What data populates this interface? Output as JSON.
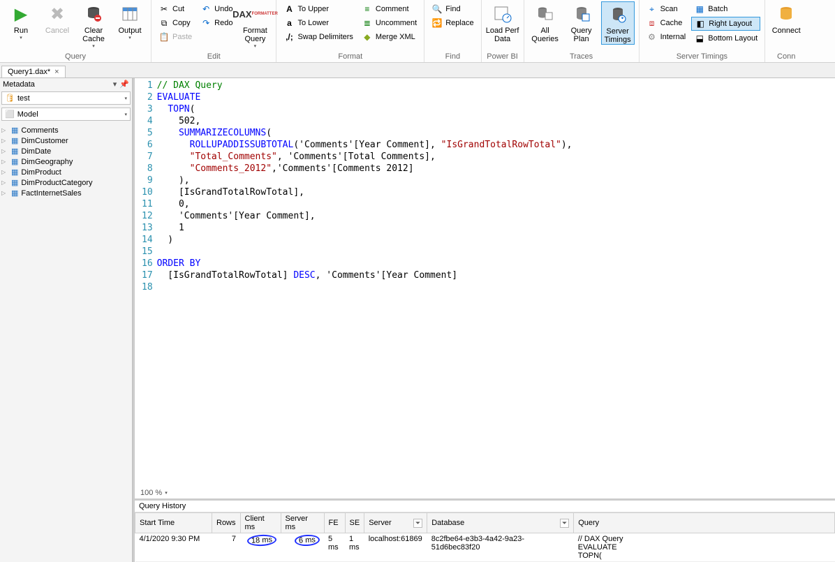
{
  "ribbon": {
    "groups": {
      "query": {
        "label": "Query",
        "run": "Run",
        "cancel": "Cancel",
        "clear": "Clear Cache",
        "output": "Output"
      },
      "edit": {
        "label": "Edit",
        "cut": "Cut",
        "copy": "Copy",
        "paste": "Paste",
        "undo": "Undo",
        "redo": "Redo",
        "format": "Format Query"
      },
      "format": {
        "label": "Format",
        "upper": "To Upper",
        "lower": "To Lower",
        "swap": "Swap Delimiters",
        "comment": "Comment",
        "uncomment": "Uncomment",
        "merge": "Merge XML"
      },
      "find": {
        "label": "Find",
        "find": "Find",
        "replace": "Replace"
      },
      "powerbi": {
        "label": "Power BI",
        "load": "Load Perf Data"
      },
      "traces": {
        "label": "Traces",
        "all": "All Queries",
        "plan": "Query Plan",
        "timings": "Server Timings"
      },
      "servertimings": {
        "label": "Server Timings",
        "scan": "Scan",
        "cache": "Cache",
        "internal": "Internal",
        "batch": "Batch",
        "right": "Right Layout",
        "bottom": "Bottom Layout"
      },
      "conn": {
        "label": "Conn",
        "connect": "Connect"
      }
    }
  },
  "tab": {
    "name": "Query1.dax*",
    "close": "×"
  },
  "metadata": {
    "title": "Metadata",
    "db": "test",
    "model": "Model",
    "tables": [
      "Comments",
      "DimCustomer",
      "DimDate",
      "DimGeography",
      "DimProduct",
      "DimProductCategory",
      "FactInternetSales"
    ]
  },
  "editor": {
    "zoom": "100 %",
    "lines": [
      {
        "n": "1",
        "h": "<span class='c-green'>// DAX Query</span>"
      },
      {
        "n": "2",
        "h": "<span class='c-blue'>EVALUATE</span>"
      },
      {
        "n": "3",
        "h": "  <span class='c-blue'>TOPN</span>("
      },
      {
        "n": "4",
        "h": "    502,"
      },
      {
        "n": "5",
        "h": "    <span class='c-blue'>SUMMARIZECOLUMNS</span>("
      },
      {
        "n": "6",
        "h": "      <span class='c-blue'>ROLLUPADDISSUBTOTAL</span>('Comments'[Year Comment], <span class='c-red'>\"IsGrandTotalRowTotal\"</span>),"
      },
      {
        "n": "7",
        "h": "      <span class='c-red'>\"Total_Comments\"</span>, 'Comments'[Total Comments],"
      },
      {
        "n": "8",
        "h": "      <span class='c-red'>\"Comments_2012\"</span>,'Comments'[Comments 2012]"
      },
      {
        "n": "9",
        "h": "    ),"
      },
      {
        "n": "10",
        "h": "    [IsGrandTotalRowTotal],"
      },
      {
        "n": "11",
        "h": "    0,"
      },
      {
        "n": "12",
        "h": "    'Comments'[Year Comment],"
      },
      {
        "n": "13",
        "h": "    1"
      },
      {
        "n": "14",
        "h": "  )"
      },
      {
        "n": "15",
        "h": ""
      },
      {
        "n": "16",
        "h": "<span class='c-blue'>ORDER BY</span>"
      },
      {
        "n": "17",
        "h": "  [IsGrandTotalRowTotal] <span class='c-blue'>DESC</span>, 'Comments'[Year Comment]"
      },
      {
        "n": "18",
        "h": ""
      }
    ]
  },
  "history": {
    "title": "Query History",
    "cols": {
      "start": "Start Time",
      "rows": "Rows",
      "client": "Client ms",
      "server": "Server ms",
      "fe": "FE",
      "se": "SE",
      "serverName": "Server",
      "db": "Database",
      "query": "Query"
    },
    "row": {
      "start": "4/1/2020 9:30 PM",
      "rows": "7",
      "client": "18 ms",
      "server": "6 ms",
      "fe": "5 ms",
      "se": "1 ms",
      "serverName": "localhost:61869",
      "db": "8c2fbe64-e3b3-4a42-9a23-51d6bec83f20",
      "q1": "// DAX Query",
      "q2": "EVALUATE",
      "q3": "  TOPN("
    }
  }
}
